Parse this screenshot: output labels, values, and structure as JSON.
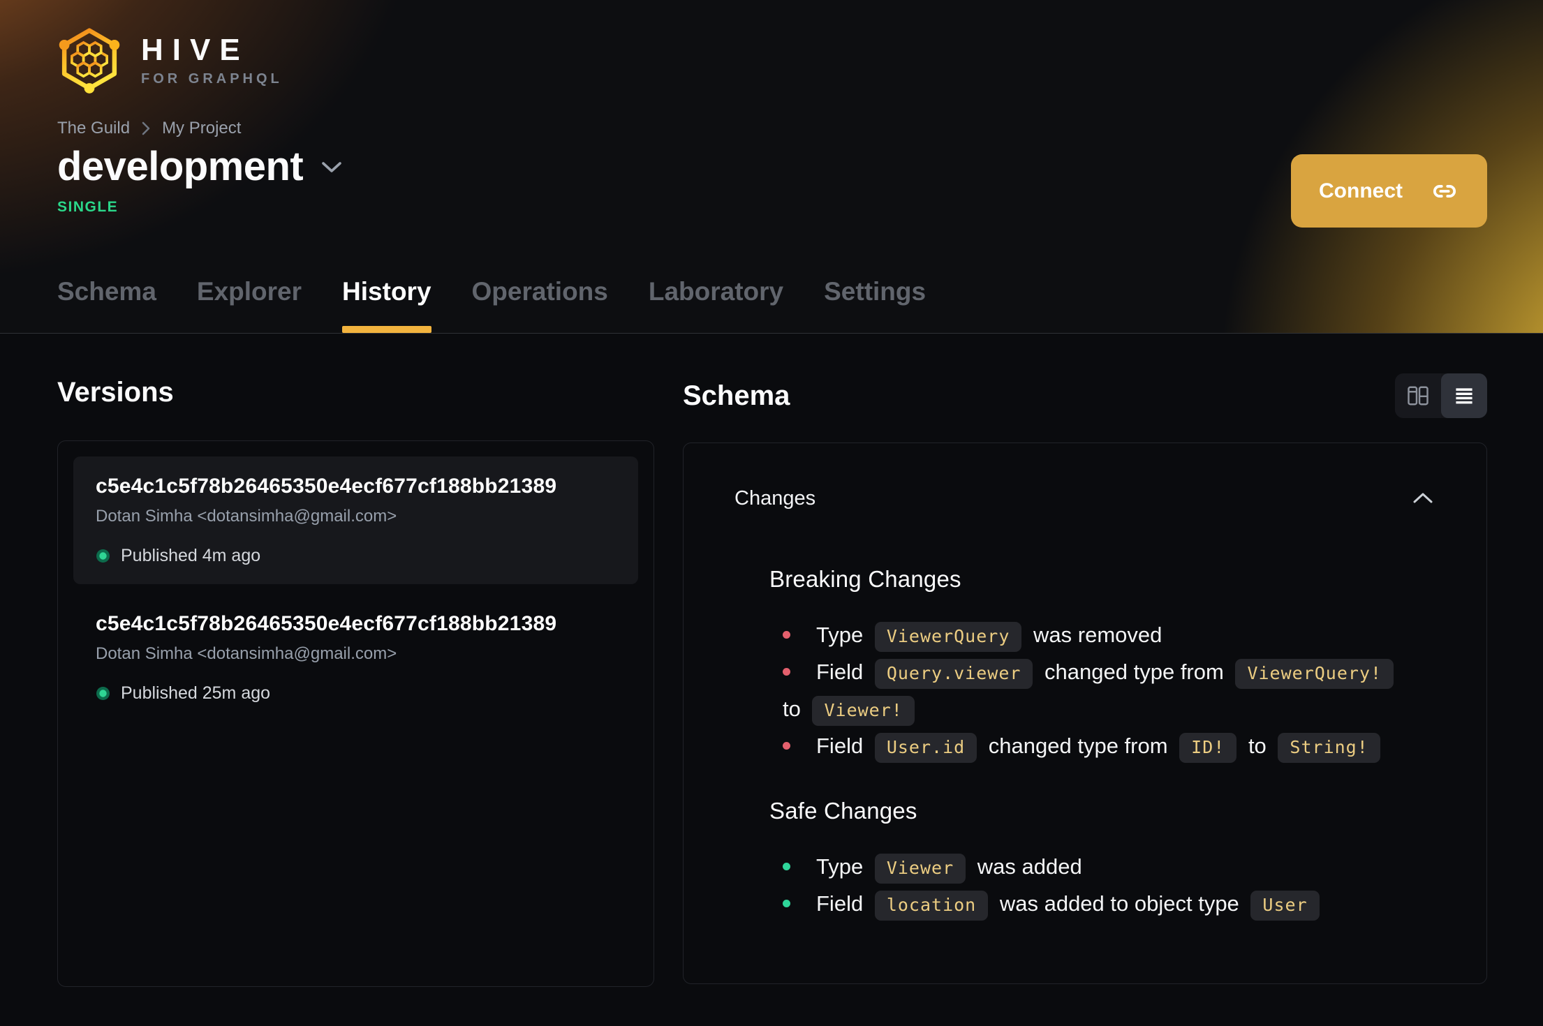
{
  "brand": {
    "name": "HIVE",
    "tagline": "FOR GRAPHQL"
  },
  "breadcrumb": {
    "org": "The Guild",
    "project": "My Project"
  },
  "project": {
    "title": "development",
    "badge": "SINGLE"
  },
  "header": {
    "connect_label": "Connect"
  },
  "tabs": [
    {
      "label": "Schema",
      "active": false
    },
    {
      "label": "Explorer",
      "active": false
    },
    {
      "label": "History",
      "active": true
    },
    {
      "label": "Operations",
      "active": false
    },
    {
      "label": "Laboratory",
      "active": false
    },
    {
      "label": "Settings",
      "active": false
    }
  ],
  "versions": {
    "title": "Versions",
    "items": [
      {
        "hash": "c5e4c1c5f78b26465350e4ecf677cf188bb21389",
        "author": "Dotan Simha <dotansimha@gmail.com>",
        "status": "Published 4m ago",
        "highlighted": true
      },
      {
        "hash": "c5e4c1c5f78b26465350e4ecf677cf188bb21389",
        "author": "Dotan Simha <dotansimha@gmail.com>",
        "status": "Published 25m ago",
        "highlighted": false
      }
    ]
  },
  "schema": {
    "title": "Schema",
    "changes_label": "Changes",
    "groups": [
      {
        "title": "Breaking Changes",
        "kind": "breaking",
        "items": [
          [
            {
              "text": "Type "
            },
            {
              "code": "ViewerQuery"
            },
            {
              "text": " was removed"
            }
          ],
          [
            {
              "text": "Field "
            },
            {
              "code": "Query.viewer"
            },
            {
              "text": " changed type from "
            },
            {
              "code": "ViewerQuery!"
            },
            {
              "br": true
            },
            {
              "text": "to "
            },
            {
              "code": "Viewer!"
            }
          ],
          [
            {
              "text": "Field "
            },
            {
              "code": "User.id"
            },
            {
              "text": " changed type from "
            },
            {
              "code": "ID!"
            },
            {
              "text": " to "
            },
            {
              "code": "String!"
            }
          ]
        ]
      },
      {
        "title": "Safe Changes",
        "kind": "safe",
        "items": [
          [
            {
              "text": "Type "
            },
            {
              "code": "Viewer"
            },
            {
              "text": " was added"
            }
          ],
          [
            {
              "text": "Field "
            },
            {
              "code": "location"
            },
            {
              "text": " was added to object type "
            },
            {
              "code": "User"
            }
          ]
        ]
      }
    ]
  },
  "icons": {
    "logo": "hive-hexagon-honeycomb",
    "breadcrumb_separator": "chevron-right",
    "title_dropdown": "chevron-down",
    "connect": "link-chain",
    "view_left": "columns-diff-view",
    "view_right": "list-view",
    "changes_collapse": "chevron-up",
    "published": "green-dot"
  },
  "colors": {
    "accent": "#d9a440",
    "tab_underline": "#f2b33e",
    "badge_green": "#2bd78a",
    "breaking_bullet": "#e4606d",
    "safe_bullet": "#2fd69a",
    "code_text": "#eccd82",
    "dot_outer": "#0d6b4c",
    "dot_inner": "#2fd594"
  }
}
